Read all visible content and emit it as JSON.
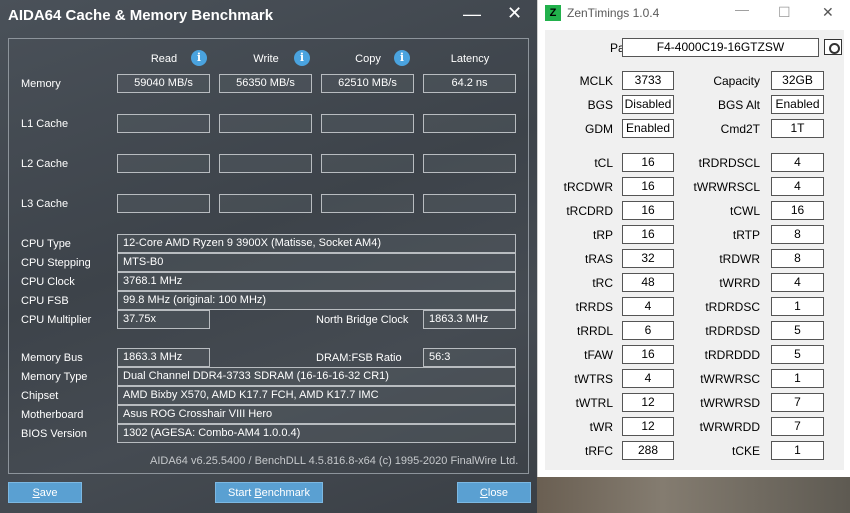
{
  "aida": {
    "title": "AIDA64 Cache & Memory Benchmark",
    "columns": {
      "read": "Read",
      "write": "Write",
      "copy": "Copy",
      "latency": "Latency"
    },
    "rows": {
      "memory": {
        "label": "Memory",
        "read": "59040 MB/s",
        "write": "56350 MB/s",
        "copy": "62510 MB/s",
        "latency": "64.2 ns"
      },
      "l1": {
        "label": "L1 Cache"
      },
      "l2": {
        "label": "L2 Cache"
      },
      "l3": {
        "label": "L3 Cache"
      }
    },
    "info": {
      "cpu_type": {
        "label": "CPU Type",
        "value": "12-Core AMD Ryzen 9 3900X  (Matisse, Socket AM4)"
      },
      "cpu_stepping": {
        "label": "CPU Stepping",
        "value": "MTS-B0"
      },
      "cpu_clock": {
        "label": "CPU Clock",
        "value": "3768.1 MHz"
      },
      "cpu_fsb": {
        "label": "CPU FSB",
        "value": "99.8 MHz  (original: 100 MHz)"
      },
      "cpu_multiplier": {
        "label": "CPU Multiplier",
        "value": "37.75x"
      },
      "nb_clock": {
        "label": "North Bridge Clock",
        "value": "1863.3 MHz"
      },
      "memory_bus": {
        "label": "Memory Bus",
        "value": "1863.3 MHz"
      },
      "dram_fsb": {
        "label": "DRAM:FSB Ratio",
        "value": "56:3"
      },
      "memory_type": {
        "label": "Memory Type",
        "value": "Dual Channel DDR4-3733 SDRAM  (16-16-16-32 CR1)"
      },
      "chipset": {
        "label": "Chipset",
        "value": "AMD Bixby X570, AMD K17.7 FCH, AMD K17.7 IMC"
      },
      "motherboard": {
        "label": "Motherboard",
        "value": "Asus ROG Crosshair VIII Hero"
      },
      "bios": {
        "label": "BIOS Version",
        "value": "1302  (AGESA: Combo-AM4 1.0.0.4)"
      }
    },
    "footer": "AIDA64 v6.25.5400 / BenchDLL 4.5.816.8-x64  (c) 1995-2020 FinalWire Ltd.",
    "buttons": {
      "save_pre": "",
      "save_u": "S",
      "save_post": "ave",
      "start_pre": "Start ",
      "start_u": "B",
      "start_post": "enchmark",
      "close_pre": "",
      "close_u": "C",
      "close_post": "lose"
    },
    "icons": {
      "info": "i"
    }
  },
  "zen": {
    "logo": "Z",
    "title": "ZenTimings 1.0.4",
    "part_label": "Part #",
    "part_value": "F4-4000C19-16GTZSW",
    "general": [
      {
        "l1": "MCLK",
        "v1": "3733",
        "l2": "Capacity",
        "v2": "32GB"
      },
      {
        "l1": "BGS",
        "v1": "Disabled",
        "l2": "BGS Alt",
        "v2": "Enabled"
      },
      {
        "l1": "GDM",
        "v1": "Enabled",
        "l2": "Cmd2T",
        "v2": "1T"
      }
    ],
    "timings": [
      {
        "l1": "tCL",
        "v1": "16",
        "l2": "tRDRDSCL",
        "v2": "4"
      },
      {
        "l1": "tRCDWR",
        "v1": "16",
        "l2": "tWRWRSCL",
        "v2": "4"
      },
      {
        "l1": "tRCDRD",
        "v1": "16",
        "l2": "tCWL",
        "v2": "16"
      },
      {
        "l1": "tRP",
        "v1": "16",
        "l2": "tRTP",
        "v2": "8"
      },
      {
        "l1": "tRAS",
        "v1": "32",
        "l2": "tRDWR",
        "v2": "8"
      },
      {
        "l1": "tRC",
        "v1": "48",
        "l2": "tWRRD",
        "v2": "4"
      },
      {
        "l1": "tRRDS",
        "v1": "4",
        "l2": "tRDRDSC",
        "v2": "1"
      },
      {
        "l1": "tRRDL",
        "v1": "6",
        "l2": "tRDRDSD",
        "v2": "5"
      },
      {
        "l1": "tFAW",
        "v1": "16",
        "l2": "tRDRDDD",
        "v2": "5"
      },
      {
        "l1": "tWTRS",
        "v1": "4",
        "l2": "tWRWRSC",
        "v2": "1"
      },
      {
        "l1": "tWTRL",
        "v1": "12",
        "l2": "tWRWRSD",
        "v2": "7"
      },
      {
        "l1": "tWR",
        "v1": "12",
        "l2": "tWRWRDD",
        "v2": "7"
      },
      {
        "l1": "tRFC",
        "v1": "288",
        "l2": "tCKE",
        "v2": "1"
      }
    ]
  }
}
